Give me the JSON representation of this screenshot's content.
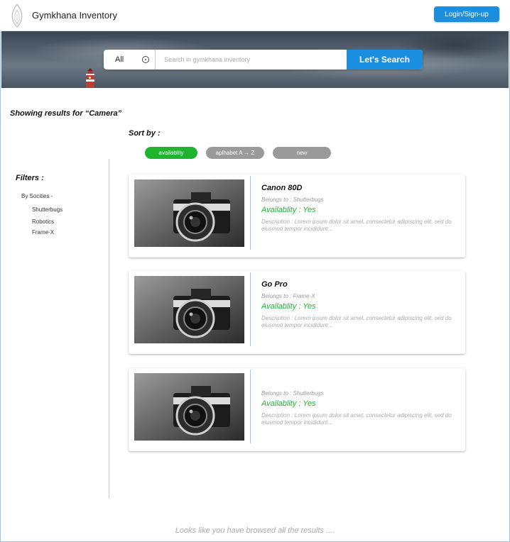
{
  "header": {
    "app_title": "Gymkhana Inventory",
    "login_label": "Login/Sign-up"
  },
  "search": {
    "category_selected": "All",
    "placeholder": "Search in gymkhana inventory",
    "button_label": "Let's Search"
  },
  "results": {
    "heading": "Showing results for “Camera”",
    "sort_label": "Sort by :",
    "sort_options": [
      "availablity",
      "aplhabet A → Z",
      "new"
    ],
    "end_note": "Looks like you have browsed all the results ...."
  },
  "filters": {
    "title": "Filters :",
    "group_label": "By Socities -",
    "items": [
      "Shutterbugs",
      "Robotics",
      "Frame-X"
    ]
  },
  "cards": [
    {
      "title": "Canon 80D",
      "belongs": "Belongs to : Shutterbugs",
      "availability": "Availablity : Yes",
      "description": "Description : Lorem ipsum dolor sit amet, consectetur adipiscing elit, sed do eiusmod tempor incididunt..."
    },
    {
      "title": "Go Pro",
      "belongs": "Belongs to : Frame-X",
      "availability": "Availablity : Yes",
      "description": "Description : Lorem ipsum dolor sit amet, consectetur adipiscing elit, sed do eiusmod tempor incididunt..."
    },
    {
      "title": "",
      "belongs": "Belongs to : Shutterbugs",
      "availability": "Availablity : Yes",
      "description": "Description : Lorem ipsum dolor sit amet, consectetur adipiscing elit, sed do eiusmod tempor incididunt..."
    }
  ],
  "colors": {
    "accent": "#1a8fe0",
    "available_green": "#1fb32e",
    "chip_gray": "#9a9a9a"
  },
  "icons": {
    "logo": "flame-logo-icon",
    "select": "dropdown-circle-icon",
    "product_image": "camera-icon"
  }
}
